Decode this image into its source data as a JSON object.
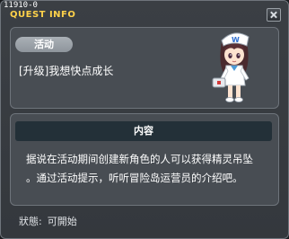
{
  "window": {
    "quest_id": "11910-0",
    "title": "QUEST INFO"
  },
  "quest": {
    "category_tag": "活动",
    "name": "[升级]我想快点成长",
    "npc_icon": "nurse-npc-character-icon"
  },
  "info": {
    "section_title": "内容",
    "lines": [
      "据说在活动期间创建新角色的人可以获得精灵吊坠",
      "。通过活动提示，听听冒险岛运营员的介绍吧。"
    ]
  },
  "status": {
    "label": "狀態:",
    "value": "可開始"
  },
  "colors": {
    "title": "#ffd24a",
    "panel": "#484d53",
    "header_bar": "#233038"
  }
}
